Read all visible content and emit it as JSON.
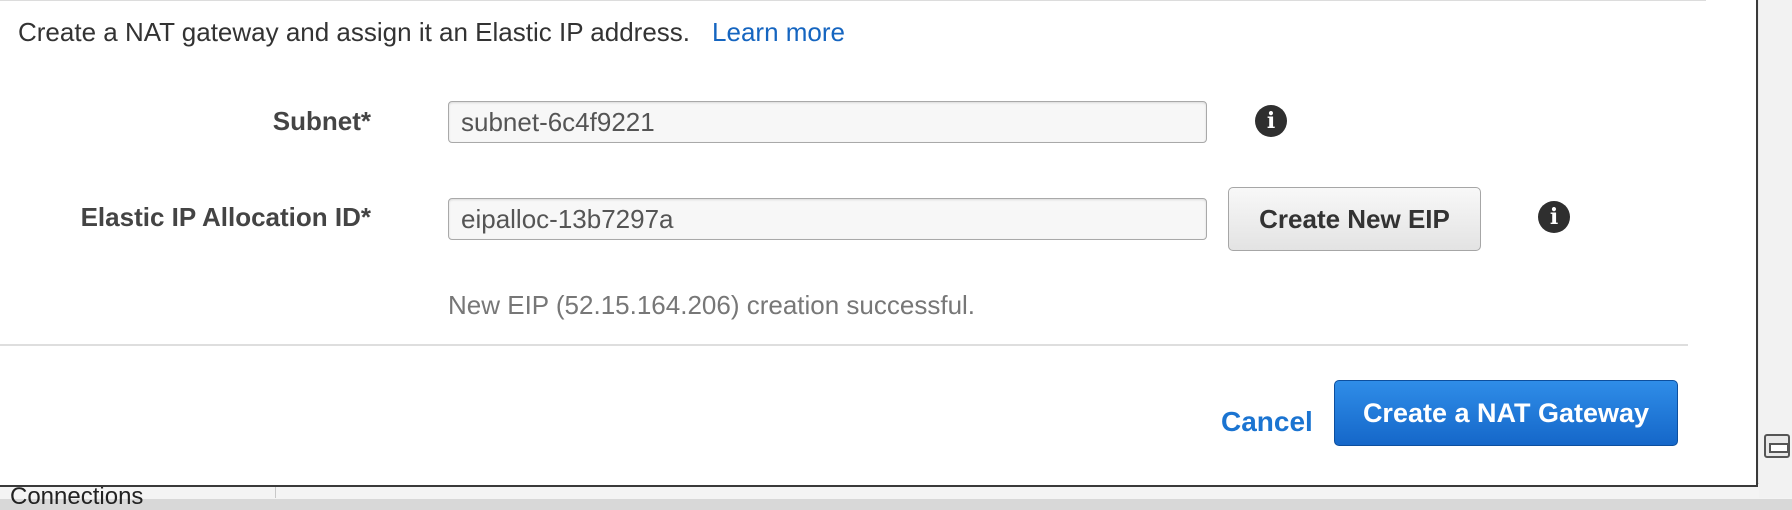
{
  "dialog": {
    "intro_text": "Create a NAT gateway and assign it an Elastic IP address.",
    "learn_more": "Learn more"
  },
  "form": {
    "subnet": {
      "label": "Subnet*",
      "value": "subnet-6c4f9221"
    },
    "eip": {
      "label": "Elastic IP Allocation ID*",
      "value": "eipalloc-13b7297a",
      "create_button": "Create New EIP",
      "success_message": "New EIP (52.15.164.206) creation successful."
    }
  },
  "footer": {
    "cancel": "Cancel",
    "submit": "Create a NAT Gateway"
  },
  "background": {
    "partial_label": "Connections"
  },
  "colors": {
    "link": "#1565c0",
    "primary_button": "#1567c9"
  },
  "icons": {
    "info": "info-icon",
    "side_panel": "panel-toggle-icon"
  }
}
